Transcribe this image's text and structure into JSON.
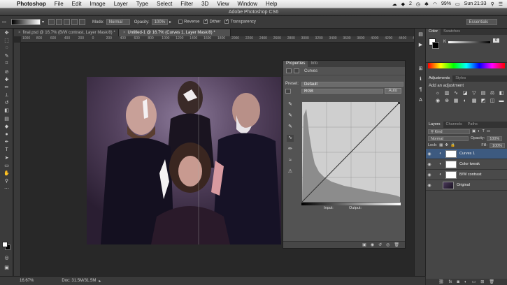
{
  "menubar": {
    "app": "Photoshop",
    "items": [
      "File",
      "Edit",
      "Image",
      "Layer",
      "Type",
      "Select",
      "Filter",
      "3D",
      "View",
      "Window",
      "Help"
    ],
    "status": {
      "badge": "2",
      "battery": "99%",
      "clock": "Sun 21:33"
    }
  },
  "window": {
    "title": "Adobe Photoshop CS6"
  },
  "options": {
    "mode_label": "Mode:",
    "mode_value": "Normal",
    "opacity_label": "Opacity:",
    "opacity_value": "100%",
    "reverse": "Reverse",
    "dither": "Dither",
    "transparency": "Transparency",
    "workspace": "Essentials"
  },
  "doc_tabs": [
    {
      "label": "final.psd @ 16.7% (B/W contrast, Layer Mask/8) *"
    },
    {
      "label": "Untitled-1 @ 16.7% (Curves 1, Layer Mask/8) *"
    }
  ],
  "ruler_labels": [
    "1000",
    "800",
    "600",
    "400",
    "200",
    "0",
    "200",
    "400",
    "600",
    "800",
    "1000",
    "1200",
    "1400",
    "1600",
    "1800",
    "2000",
    "2200",
    "2400",
    "2600",
    "2800",
    "3000",
    "3200",
    "3400",
    "3600",
    "3800",
    "4000",
    "4200",
    "4400",
    "4600"
  ],
  "status_bar": {
    "zoom": "16.67%",
    "doc": "Doc: 31.5M/31.5M"
  },
  "properties": {
    "tabs": [
      "Properties",
      "Info"
    ],
    "title": "Curves",
    "preset_label": "Preset:",
    "preset_value": "Default",
    "channel": "RGB",
    "auto": "Auto",
    "input_label": "Input:",
    "output_label": "Output:"
  },
  "dock": {
    "color_tabs": [
      "Color",
      "Swatches"
    ],
    "color_k": "K",
    "color_pct": "0",
    "adj_tabs": [
      "Adjustments",
      "Styles"
    ],
    "adj_title": "Add an adjustment",
    "layer_tabs": [
      "Layers",
      "Channels",
      "Paths"
    ],
    "kind": "Kind",
    "blend": "Normal",
    "opacity_label": "Opacity:",
    "opacity_value": "100%",
    "lock_label": "Lock:",
    "fill_label": "Fill:",
    "fill_value": "100%",
    "layers": [
      {
        "name": "Curves 1",
        "selected": true
      },
      {
        "name": "Color tweak",
        "selected": false
      },
      {
        "name": "B/W contrast",
        "selected": false
      },
      {
        "name": "Original",
        "selected": false
      }
    ]
  }
}
